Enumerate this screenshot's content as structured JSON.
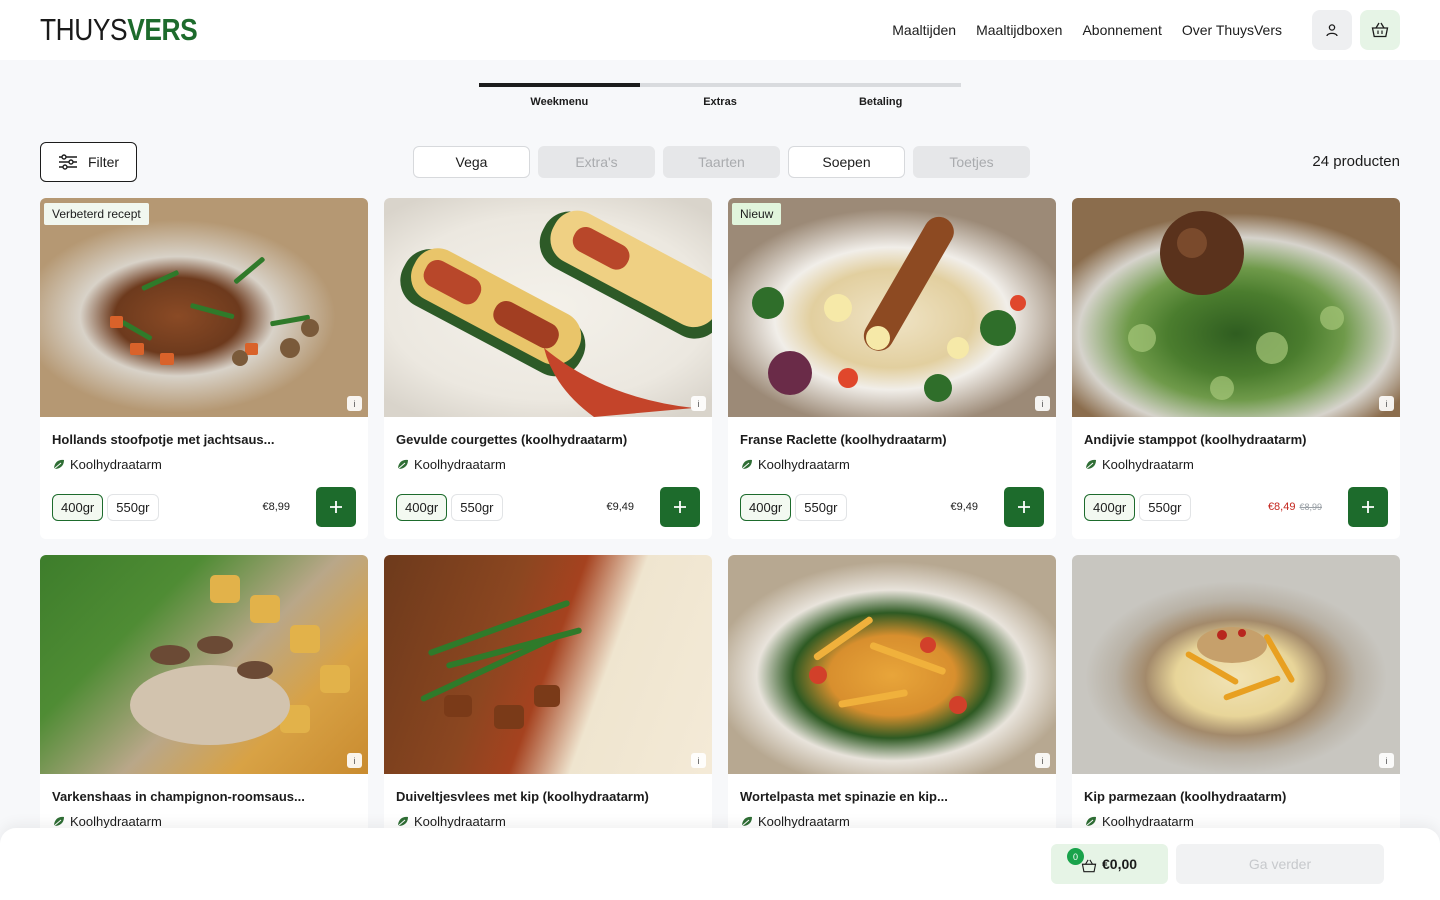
{
  "brand": {
    "part1": "THUYS",
    "part2": "VERS"
  },
  "nav": [
    "Maaltijden",
    "Maaltijdboxen",
    "Abonnement",
    "Over ThuysVers"
  ],
  "steps": [
    {
      "label": "Weekmenu",
      "active": true
    },
    {
      "label": "Extras",
      "active": false
    },
    {
      "label": "Betaling",
      "active": false
    }
  ],
  "filter_label": "Filter",
  "categories": [
    {
      "label": "Vega",
      "enabled": true
    },
    {
      "label": "Extra's",
      "enabled": false
    },
    {
      "label": "Taarten",
      "enabled": false
    },
    {
      "label": "Soepen",
      "enabled": true
    },
    {
      "label": "Toetjes",
      "enabled": false
    }
  ],
  "product_count": "24 producten",
  "products": [
    {
      "badge": "Verbeterd recept",
      "title": "Hollands stoofpotje met jachtsaus...",
      "tag": "Koolhydraatarm",
      "sizes": [
        "400gr",
        "550gr"
      ],
      "price": "€8,99",
      "old_price": ""
    },
    {
      "badge": "",
      "title": "Gevulde courgettes (koolhydraatarm)",
      "tag": "Koolhydraatarm",
      "sizes": [
        "400gr",
        "550gr"
      ],
      "price": "€9,49",
      "old_price": ""
    },
    {
      "badge": "Nieuw",
      "title": "Franse Raclette (koolhydraatarm)",
      "tag": "Koolhydraatarm",
      "sizes": [
        "400gr",
        "550gr"
      ],
      "price": "€9,49",
      "old_price": ""
    },
    {
      "badge": "",
      "title": "Andijvie stamppot (koolhydraatarm)",
      "tag": "Koolhydraatarm",
      "sizes": [
        "400gr",
        "550gr"
      ],
      "price": "€8,49",
      "old_price": "€8,99"
    },
    {
      "badge": "",
      "title": "Varkenshaas in champignon-roomsaus...",
      "tag": "Koolhydraatarm",
      "sizes": [],
      "price": "",
      "old_price": ""
    },
    {
      "badge": "",
      "title": "Duiveltjesvlees met kip (koolhydraatarm)",
      "tag": "Koolhydraatarm",
      "sizes": [],
      "price": "",
      "old_price": ""
    },
    {
      "badge": "",
      "title": "Wortelpasta met spinazie en kip...",
      "tag": "Koolhydraatarm",
      "sizes": [],
      "price": "",
      "old_price": ""
    },
    {
      "badge": "",
      "title": "Kip parmezaan (koolhydraatarm)",
      "tag": "Koolhydraatarm",
      "sizes": [],
      "price": "",
      "old_price": ""
    }
  ],
  "cart": {
    "count": "0",
    "total": "€0,00"
  },
  "continue_label": "Ga verder",
  "colors": {
    "brand_green": "#1d6b2c",
    "sale_red": "#c4251d",
    "count_green": "#19a34b"
  }
}
